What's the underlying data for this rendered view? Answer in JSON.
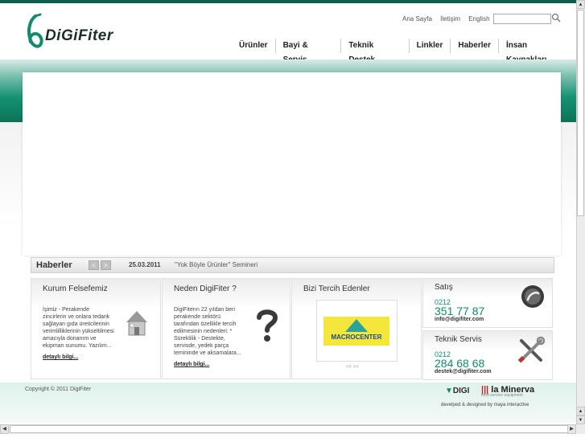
{
  "header": {
    "logo_text": "DiGiFiter",
    "top_links": [
      "Ana Sayfa",
      "İletişim",
      "English"
    ],
    "search_placeholder": ""
  },
  "nav": [
    "Ürünler",
    "Bayi & Servis",
    "Teknik Destek",
    "Linkler",
    "Haberler",
    "İnsan Kaynakları"
  ],
  "news": {
    "title": "Haberler",
    "prev": "<",
    "next": ">",
    "date": "25.03.2011",
    "headline": "\"Yok Böyle Ürünler\" Semineri"
  },
  "panels": {
    "philosophy": {
      "title": "Kurum Felsefemiz",
      "lines": [
        "İşimiz -  Perakende",
        "zincirlerin ve onlara tedarik",
        "sağlayan gıda üreticilerinin",
        "verimlilliklerinin yükseltilmesi",
        "amacıyla donanım ve",
        "ekipman sunumu. Yazılım..."
      ],
      "more": "detaylı bilgi..."
    },
    "why": {
      "title": "Neden DigiFiter ?",
      "lines": [
        "DigiFiterın 22 yıldan beri",
        "perakende sektörü",
        "tarafından özellikle tercih",
        "edilmesinin nedenleri: *",
        "Süreklilik - Destekte,",
        "servisde, yedek parça",
        "temininde ve aksamalara..."
      ],
      "more": "detaylı bilgi..."
    },
    "clients": {
      "title": "Bizi Tercih Edenler",
      "logo_text": "MACROCENTER",
      "pager": "<<   >>"
    }
  },
  "contacts": {
    "sales": {
      "title": "Satış",
      "area": "0212",
      "phone": "351 77 87",
      "email": "info@digifiter.com"
    },
    "service": {
      "title": "Teknik Servis",
      "area": "0212",
      "phone": "284 68 68",
      "email": "destek@digifiter.com"
    }
  },
  "footer": {
    "copyright": "Copyright © 2011 DigiFiter",
    "brand1": "DIGI",
    "brand2": "la Minerva",
    "brand2_sub": "food service equipment",
    "credits": "develped & designed by maya interactive"
  },
  "colors": {
    "brand_green": "#138a6c",
    "top_stripe": "#0e5d4c"
  }
}
